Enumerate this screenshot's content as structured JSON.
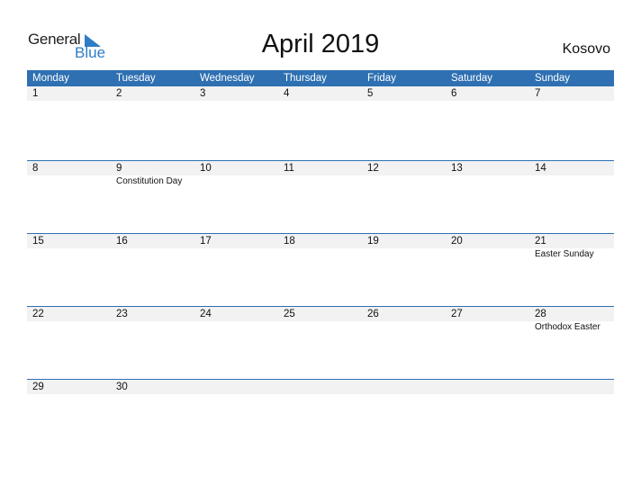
{
  "logo": {
    "line1": "General",
    "line2": "Blue",
    "accent": "#2E7DC6"
  },
  "title": "April 2019",
  "country": "Kosovo",
  "colors": {
    "header_bg": "#2E70B2",
    "date_strip": "#F2F2F2"
  },
  "weekdays": [
    "Monday",
    "Tuesday",
    "Wednesday",
    "Thursday",
    "Friday",
    "Saturday",
    "Sunday"
  ],
  "weeks": [
    {
      "days": [
        {
          "d": "1",
          "e": ""
        },
        {
          "d": "2",
          "e": ""
        },
        {
          "d": "3",
          "e": ""
        },
        {
          "d": "4",
          "e": ""
        },
        {
          "d": "5",
          "e": ""
        },
        {
          "d": "6",
          "e": ""
        },
        {
          "d": "7",
          "e": ""
        }
      ]
    },
    {
      "days": [
        {
          "d": "8",
          "e": ""
        },
        {
          "d": "9",
          "e": "Constitution Day"
        },
        {
          "d": "10",
          "e": ""
        },
        {
          "d": "11",
          "e": ""
        },
        {
          "d": "12",
          "e": ""
        },
        {
          "d": "13",
          "e": ""
        },
        {
          "d": "14",
          "e": ""
        }
      ]
    },
    {
      "days": [
        {
          "d": "15",
          "e": ""
        },
        {
          "d": "16",
          "e": ""
        },
        {
          "d": "17",
          "e": ""
        },
        {
          "d": "18",
          "e": ""
        },
        {
          "d": "19",
          "e": ""
        },
        {
          "d": "20",
          "e": ""
        },
        {
          "d": "21",
          "e": "Easter Sunday"
        }
      ]
    },
    {
      "days": [
        {
          "d": "22",
          "e": ""
        },
        {
          "d": "23",
          "e": ""
        },
        {
          "d": "24",
          "e": ""
        },
        {
          "d": "25",
          "e": ""
        },
        {
          "d": "26",
          "e": ""
        },
        {
          "d": "27",
          "e": ""
        },
        {
          "d": "28",
          "e": "Orthodox Easter"
        }
      ]
    },
    {
      "days": [
        {
          "d": "29",
          "e": ""
        },
        {
          "d": "30",
          "e": ""
        },
        {
          "d": "",
          "e": ""
        },
        {
          "d": "",
          "e": ""
        },
        {
          "d": "",
          "e": ""
        },
        {
          "d": "",
          "e": ""
        },
        {
          "d": "",
          "e": ""
        }
      ]
    }
  ]
}
